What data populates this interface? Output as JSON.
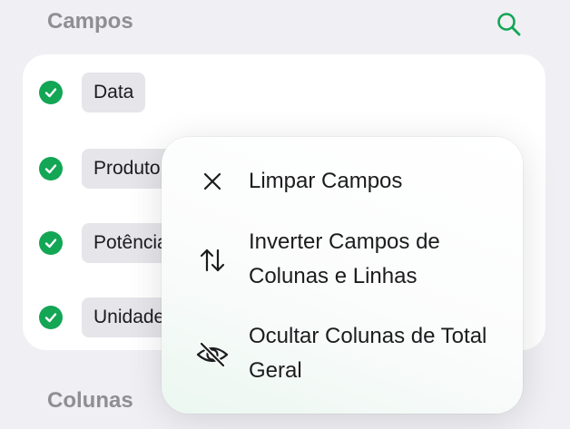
{
  "sections": {
    "fields_title": "Campos",
    "columns_title": "Colunas"
  },
  "fields": [
    {
      "label": "Data",
      "checked": true
    },
    {
      "label": "Produto",
      "checked": true
    },
    {
      "label": "Potência",
      "checked": true
    },
    {
      "label": "Unidades",
      "checked": true
    }
  ],
  "menu": {
    "items": [
      {
        "label": "Limpar Campos",
        "icon": "x-icon"
      },
      {
        "label": "Inverter Campos de Colunas e Linhas",
        "icon": "swap-arrows-icon"
      },
      {
        "label": "Ocultar Colunas de Total Geral",
        "icon": "eye-slash-icon"
      }
    ]
  },
  "colors": {
    "accent": "#13a655",
    "background": "#efeff4",
    "section_title": "#8e8e93"
  }
}
